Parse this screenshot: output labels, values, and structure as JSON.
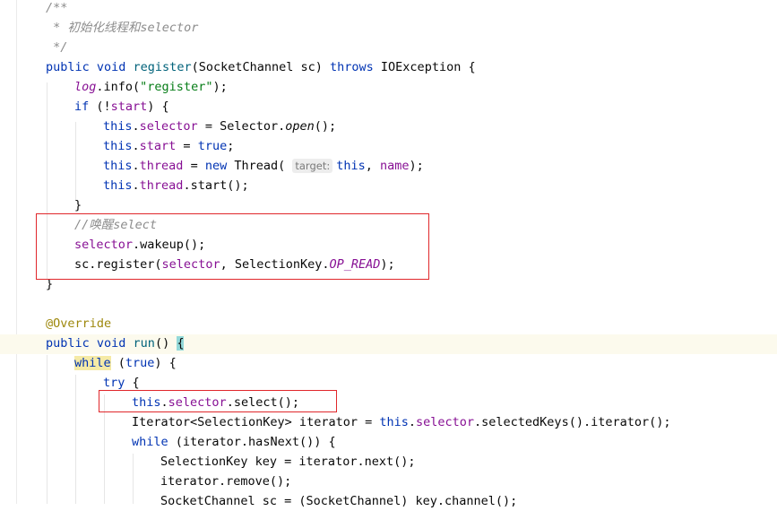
{
  "lines": [
    {
      "indent": 1,
      "tokens": [
        {
          "t": "/**",
          "c": "c-com"
        }
      ]
    },
    {
      "indent": 1,
      "tokens": [
        {
          "t": " * 初始化线程和selector",
          "c": "c-com"
        }
      ]
    },
    {
      "indent": 1,
      "tokens": [
        {
          "t": " */",
          "c": "c-com"
        }
      ]
    },
    {
      "indent": 1,
      "tokens": [
        {
          "t": "public void ",
          "c": "c-kw"
        },
        {
          "t": "register",
          "c": "c-fn"
        },
        {
          "t": "(SocketChannel sc) ",
          "c": ""
        },
        {
          "t": "throws ",
          "c": "c-kw"
        },
        {
          "t": "IOException {",
          "c": ""
        }
      ]
    },
    {
      "indent": 2,
      "tokens": [
        {
          "t": "log",
          "c": "c-ital-fld"
        },
        {
          "t": ".info(",
          "c": ""
        },
        {
          "t": "\"register\"",
          "c": "c-str"
        },
        {
          "t": ");",
          "c": ""
        }
      ]
    },
    {
      "indent": 2,
      "tokens": [
        {
          "t": "if ",
          "c": "c-kw"
        },
        {
          "t": "(!",
          "c": ""
        },
        {
          "t": "start",
          "c": "c-fld"
        },
        {
          "t": ") {",
          "c": ""
        }
      ]
    },
    {
      "indent": 3,
      "tokens": [
        {
          "t": "this",
          "c": "c-kw"
        },
        {
          "t": ".",
          "c": ""
        },
        {
          "t": "selector",
          "c": "c-fld"
        },
        {
          "t": " = Selector.",
          "c": ""
        },
        {
          "t": "open",
          "c": "c-it"
        },
        {
          "t": "();",
          "c": ""
        }
      ]
    },
    {
      "indent": 3,
      "tokens": [
        {
          "t": "this",
          "c": "c-kw"
        },
        {
          "t": ".",
          "c": ""
        },
        {
          "t": "start",
          "c": "c-fld"
        },
        {
          "t": " = ",
          "c": ""
        },
        {
          "t": "true",
          "c": "c-kw"
        },
        {
          "t": ";",
          "c": ""
        }
      ]
    },
    {
      "indent": 3,
      "tokens": [
        {
          "t": "this",
          "c": "c-kw"
        },
        {
          "t": ".",
          "c": ""
        },
        {
          "t": "thread",
          "c": "c-fld"
        },
        {
          "t": " = ",
          "c": ""
        },
        {
          "t": "new ",
          "c": "c-kw"
        },
        {
          "t": "Thread( ",
          "c": ""
        },
        {
          "t": "target:",
          "c": "hint"
        },
        {
          "t": "this",
          "c": "c-kw"
        },
        {
          "t": ", ",
          "c": ""
        },
        {
          "t": "name",
          "c": "c-fld"
        },
        {
          "t": ");",
          "c": ""
        }
      ]
    },
    {
      "indent": 3,
      "tokens": [
        {
          "t": "this",
          "c": "c-kw"
        },
        {
          "t": ".",
          "c": ""
        },
        {
          "t": "thread",
          "c": "c-fld"
        },
        {
          "t": ".start();",
          "c": ""
        }
      ]
    },
    {
      "indent": 2,
      "tokens": [
        {
          "t": "}",
          "c": ""
        }
      ]
    },
    {
      "indent": 2,
      "tokens": [
        {
          "t": "//唤醒select",
          "c": "c-com"
        }
      ]
    },
    {
      "indent": 2,
      "tokens": [
        {
          "t": "selector",
          "c": "c-fld"
        },
        {
          "t": ".wakeup();",
          "c": ""
        }
      ]
    },
    {
      "indent": 2,
      "tokens": [
        {
          "t": "sc.register(",
          "c": ""
        },
        {
          "t": "selector",
          "c": "c-fld"
        },
        {
          "t": ", SelectionKey.",
          "c": ""
        },
        {
          "t": "OP_READ",
          "c": "c-ital-fld"
        },
        {
          "t": ");",
          "c": ""
        }
      ]
    },
    {
      "indent": 1,
      "tokens": [
        {
          "t": "}",
          "c": ""
        }
      ]
    },
    {
      "indent": 0,
      "tokens": []
    },
    {
      "indent": 1,
      "tokens": [
        {
          "t": "@Override",
          "c": "c-ann"
        }
      ]
    },
    {
      "indent": 1,
      "tokens": [
        {
          "t": "public void ",
          "c": "c-kw"
        },
        {
          "t": "run",
          "c": "c-fn"
        },
        {
          "t": "() ",
          "c": ""
        },
        {
          "t": "{",
          "c": "brace-hl"
        }
      ]
    },
    {
      "indent": 2,
      "tokens": [
        {
          "t": "while",
          "c": "c-kw while-hl"
        },
        {
          "t": " (",
          "c": ""
        },
        {
          "t": "true",
          "c": "c-kw"
        },
        {
          "t": ") {",
          "c": ""
        }
      ]
    },
    {
      "indent": 3,
      "tokens": [
        {
          "t": "try ",
          "c": "c-kw"
        },
        {
          "t": "{",
          "c": ""
        }
      ]
    },
    {
      "indent": 4,
      "tokens": [
        {
          "t": "this",
          "c": "c-kw"
        },
        {
          "t": ".",
          "c": ""
        },
        {
          "t": "selector",
          "c": "c-fld"
        },
        {
          "t": ".select();",
          "c": ""
        }
      ]
    },
    {
      "indent": 4,
      "tokens": [
        {
          "t": "Iterator<SelectionKey> iterator = ",
          "c": ""
        },
        {
          "t": "this",
          "c": "c-kw"
        },
        {
          "t": ".",
          "c": ""
        },
        {
          "t": "selector",
          "c": "c-fld"
        },
        {
          "t": ".selectedKeys().iterator();",
          "c": ""
        }
      ]
    },
    {
      "indent": 4,
      "tokens": [
        {
          "t": "while ",
          "c": "c-kw"
        },
        {
          "t": "(iterator.hasNext()) {",
          "c": ""
        }
      ]
    },
    {
      "indent": 5,
      "tokens": [
        {
          "t": "SelectionKey key = iterator.next();",
          "c": ""
        }
      ]
    },
    {
      "indent": 5,
      "tokens": [
        {
          "t": "iterator.remove();",
          "c": ""
        }
      ]
    },
    {
      "indent": 5,
      "tokens": [
        {
          "t": "SocketChannel sc = (SocketChannel) key.channel();",
          "c": ""
        }
      ]
    }
  ],
  "highlight_boxes": [
    {
      "name": "annotation-box-wakeup-block"
    },
    {
      "name": "annotation-box-select-call"
    }
  ],
  "colors": {
    "keyword": "#0033b3",
    "field": "#871094",
    "string": "#067d17",
    "comment": "#8c8c8c",
    "annotation": "#9e880d",
    "box": "#e0272b"
  }
}
